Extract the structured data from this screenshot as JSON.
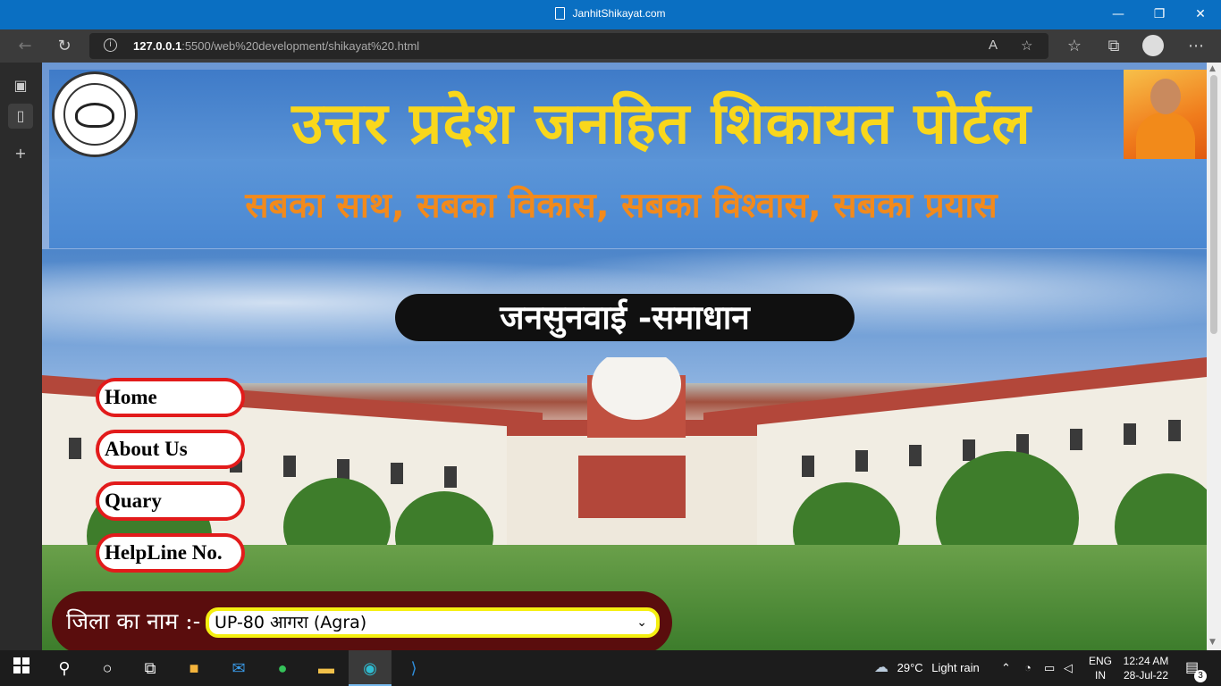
{
  "window": {
    "title": "JanhitShikayat.com",
    "minimize_glyph": "—",
    "restore_glyph": "❐",
    "close_glyph": "✕"
  },
  "browser": {
    "url_host": "127.0.0.1",
    "url_path": ":5500/web%20development/shikayat%20.html",
    "back_icon": "back-arrow-icon",
    "reload_icon": "reload-icon"
  },
  "header": {
    "title": "उत्तर प्रदेश जनहित शिकायत पोर्टल",
    "slogan": "सबका साथ, सबका विकास, सबका विश्वास, सबका प्रयास",
    "title_color": "#f9d71c",
    "slogan_color": "#f28a1c"
  },
  "banner": {
    "label": "जनसुनवाई -समाधान"
  },
  "menu": [
    {
      "label": "Home"
    },
    {
      "label": "About Us"
    },
    {
      "label": "Quary"
    },
    {
      "label": "HelpLine No."
    }
  ],
  "district": {
    "label": "जिला का नाम :-",
    "selected": "UP-80 आगरा (Agra)"
  },
  "taskbar": {
    "weather_temp": "29°C",
    "weather_desc": "Light rain",
    "lang_top": "ENG",
    "lang_bottom": "IN",
    "time": "12:24 AM",
    "date": "28-Jul-22",
    "notif_count": "3"
  }
}
